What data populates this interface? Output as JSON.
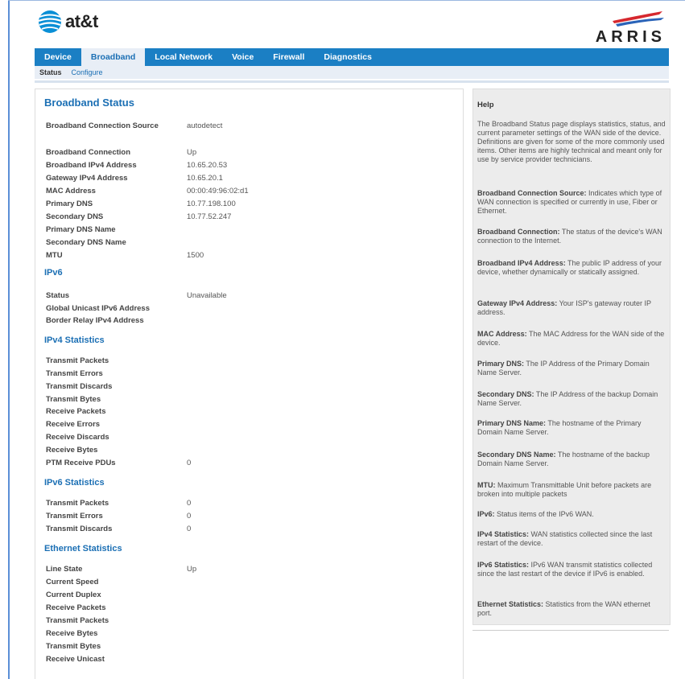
{
  "header": {
    "att_logo_text": "at&t",
    "arris_logo_text": "ARRIS"
  },
  "nav": {
    "tabs": [
      "Device",
      "Broadband",
      "Local Network",
      "Voice",
      "Firewall",
      "Diagnostics"
    ],
    "active": "Broadband"
  },
  "subnav": {
    "items": [
      "Status",
      "Configure"
    ],
    "active": "Status"
  },
  "main": {
    "title": "Broadband Status",
    "connection_source": {
      "label": "Broadband Connection Source",
      "value": "autodetect"
    },
    "status_rows": [
      {
        "label": "Broadband Connection",
        "value": "Up"
      },
      {
        "label": "Broadband IPv4 Address",
        "value": "10.65.20.53"
      },
      {
        "label": "Gateway IPv4 Address",
        "value": "10.65.20.1"
      },
      {
        "label": "MAC Address",
        "value": "00:00:49:96:02:d1"
      },
      {
        "label": "Primary DNS",
        "value": "10.77.198.100"
      },
      {
        "label": "Secondary DNS",
        "value": "10.77.52.247"
      },
      {
        "label": "Primary DNS Name",
        "value": ""
      },
      {
        "label": "Secondary DNS Name",
        "value": ""
      },
      {
        "label": "MTU",
        "value": "1500"
      }
    ],
    "ipv6": {
      "title": "IPv6",
      "rows": [
        {
          "label": "Status",
          "value": "Unavailable"
        },
        {
          "label": "Global Unicast IPv6 Address",
          "value": ""
        },
        {
          "label": "Border Relay IPv4 Address",
          "value": ""
        }
      ]
    },
    "ipv4_stats": {
      "title": "IPv4 Statistics",
      "rows": [
        {
          "label": "Transmit Packets",
          "value": ""
        },
        {
          "label": "Transmit Errors",
          "value": ""
        },
        {
          "label": "Transmit Discards",
          "value": ""
        },
        {
          "label": "Transmit Bytes",
          "value": ""
        },
        {
          "label": "Receive Packets",
          "value": ""
        },
        {
          "label": "Receive Errors",
          "value": ""
        },
        {
          "label": "Receive Discards",
          "value": ""
        },
        {
          "label": "Receive Bytes",
          "value": ""
        },
        {
          "label": "PTM Receive PDUs",
          "value": "0"
        }
      ]
    },
    "ipv6_stats": {
      "title": "IPv6 Statistics",
      "rows": [
        {
          "label": "Transmit Packets",
          "value": "0"
        },
        {
          "label": "Transmit Errors",
          "value": "0"
        },
        {
          "label": "Transmit Discards",
          "value": "0"
        }
      ]
    },
    "ethernet_stats": {
      "title": "Ethernet Statistics",
      "rows": [
        {
          "label": "Line State",
          "value": "Up"
        },
        {
          "label": "Current Speed",
          "value": ""
        },
        {
          "label": "Current Duplex",
          "value": ""
        },
        {
          "label": "Receive Packets",
          "value": ""
        },
        {
          "label": "Transmit Packets",
          "value": ""
        },
        {
          "label": "Receive Bytes",
          "value": ""
        },
        {
          "label": "Transmit Bytes",
          "value": ""
        },
        {
          "label": "Receive Unicast",
          "value": ""
        }
      ]
    }
  },
  "help": {
    "title": "Help",
    "intro": "The Broadband Status page displays statistics, status, and current parameter settings of the WAN side of the device. Definitions are given for some of the more commonly used items. Other items are highly technical and meant only for use by service provider technicians.",
    "entries": [
      {
        "term": "Broadband Connection Source:",
        "text": "Indicates which type of WAN connection is specified or currently in use, Fiber or Ethernet."
      },
      {
        "term": "Broadband Connection:",
        "text": "The status of the device's WAN connection to the Internet."
      },
      {
        "term": "Broadband IPv4 Address:",
        "text": "The public IP address of your device, whether dynamically or statically assigned."
      },
      {
        "term": "Gateway IPv4 Address:",
        "text": "Your ISP's gateway router IP address."
      },
      {
        "term": "MAC Address:",
        "text": "The MAC Address for the WAN side of the device."
      },
      {
        "term": "Primary DNS:",
        "text": "The IP Address of the Primary Domain Name Server."
      },
      {
        "term": "Secondary DNS:",
        "text": "The IP Address of the backup Domain Name Server."
      },
      {
        "term": "Primary DNS Name:",
        "text": "The hostname of the Primary Domain Name Server."
      },
      {
        "term": "Secondary DNS Name:",
        "text": "The hostname of the backup Domain Name Server."
      },
      {
        "term": "MTU:",
        "text": "Maximum Transmittable Unit before packets are broken into multiple packets"
      },
      {
        "term": "IPv6:",
        "text": "Status items of the IPv6 WAN."
      },
      {
        "term": "IPv4 Statistics:",
        "text": "WAN statistics collected since the last restart of the device."
      },
      {
        "term": "IPv6 Statistics:",
        "text": "IPv6 WAN transmit statistics collected since the last restart of the device if IPv6 is enabled."
      },
      {
        "term": "Ethernet Statistics:",
        "text": "Statistics from the WAN ethernet port."
      }
    ]
  },
  "colors": {
    "nav_blue": "#1b7fc4",
    "title_blue": "#1b6fb4",
    "att_blue": "#0a8fd6",
    "arris_red": "#d6282e",
    "arris_blue": "#2a63b8"
  }
}
